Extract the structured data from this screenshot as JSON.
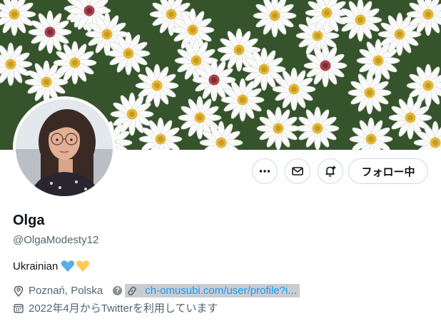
{
  "profile": {
    "name": "Olga",
    "handle": "@OlgaModesty12",
    "bio": "Ukrainian",
    "location": "Poznań, Polska",
    "link": "ch-omusubi.com/user/profile?i...",
    "joined": "2022年4月からTwitterを利用しています"
  },
  "actions": {
    "follow_label": "フォロー中"
  },
  "icons": {
    "more": "more-dots-icon",
    "message": "envelope-icon",
    "notify": "bell-plus-icon",
    "location": "location-pin-icon",
    "help": "question-badge-icon",
    "link": "link-chain-icon",
    "calendar": "calendar-icon",
    "heart_blue": "blue-heart-icon",
    "heart_yellow": "yellow-heart-icon"
  },
  "colors": {
    "text_primary": "#0f1419",
    "text_secondary": "#536471",
    "link": "#1d9bf0",
    "heart_blue": "#5aaee8",
    "heart_yellow": "#fdcb58"
  }
}
